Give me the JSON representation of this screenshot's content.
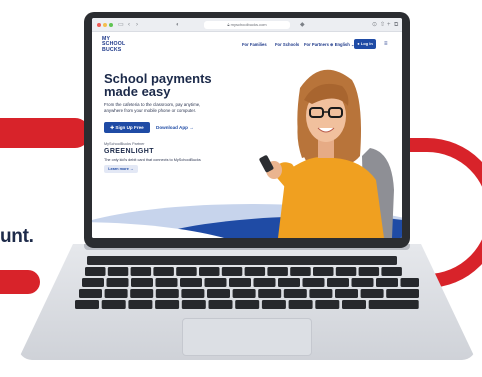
{
  "background": {
    "partial_text": "unt."
  },
  "browser": {
    "url": "myschoolbucks.com"
  },
  "nav": {
    "logo_line1": "MY",
    "logo_line2": "SCHOOL",
    "logo_line3": "BUCKS",
    "links": [
      "For Families",
      "For Schools",
      "For Partners"
    ],
    "language": "English",
    "login_label": "Log In"
  },
  "hero": {
    "title_line1": "School payments",
    "title_line2": "made easy",
    "subtitle_line1": "From the cafeteria to the classroom, pay anytime,",
    "subtitle_line2": "anywhere from your mobile phone or computer.",
    "signup_label": "Sign Up Free",
    "download_label": "Download App"
  },
  "promo": {
    "eyebrow": "MySchoolBucks Partner",
    "brand": "GREENLIGHT",
    "description": "The only kid's debit card that connects to MySchoolBucks",
    "learn_label": "Learn more"
  },
  "colors": {
    "brand_blue": "#1f4ba5",
    "navy": "#1c2a4a",
    "accent_red": "#d8232a",
    "sweater": "#f0a020"
  }
}
